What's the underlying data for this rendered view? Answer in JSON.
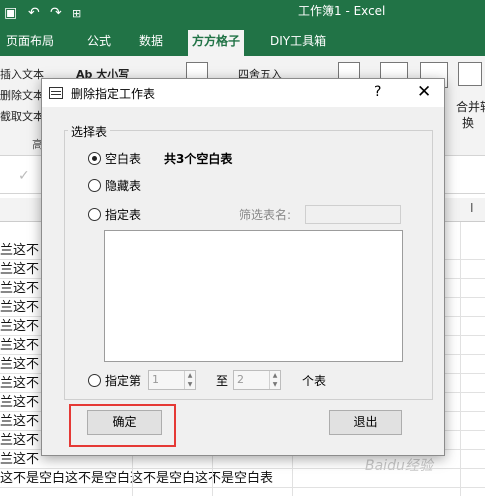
{
  "titlebar": {
    "title": "工作簿1 - Excel",
    "quick_access": [
      "save-icon",
      "undo-icon",
      "redo-icon",
      "customize-icon"
    ]
  },
  "ribbon": {
    "tabs": [
      "页面布局",
      "公式",
      "数据",
      "方方格子",
      "DIY工具箱"
    ],
    "active_tab": "方方格子",
    "left_items": [
      "插入文本",
      "删除文本",
      "截取文本"
    ],
    "case_item": "Ab 大小写",
    "round_item": "四舍五入",
    "merge_item": "合并转",
    "merge_item2": "换",
    "group_label": "高"
  },
  "sheet": {
    "rows": [
      "兰这不",
      "兰这不",
      "兰这不",
      "兰这不",
      "兰这不",
      "兰这不",
      "兰这不",
      "兰这不",
      "兰这不",
      "兰这不",
      "兰这不",
      "兰这不",
      "这不是空白这不是空白这不是空白这不是空白表"
    ],
    "col_header_right": "I"
  },
  "dialog": {
    "title": "删除指定工作表",
    "help": "?",
    "close": "✕",
    "group_label": "选择表",
    "radio_blank": "空白表",
    "blank_count": "共3个空白表",
    "radio_hidden": "隐藏表",
    "radio_named": "指定表",
    "filter_label": "筛选表名:",
    "radio_index": "指定第",
    "from_value": "1",
    "to_label": "至",
    "to_value": "2",
    "unit_label": "个表",
    "ok_button": "确定",
    "exit_button": "退出"
  },
  "colors": {
    "excel_green": "#217346",
    "dialog_bg": "#f0f0f0",
    "highlight": "#e53935"
  },
  "watermark": "Baidu经验"
}
